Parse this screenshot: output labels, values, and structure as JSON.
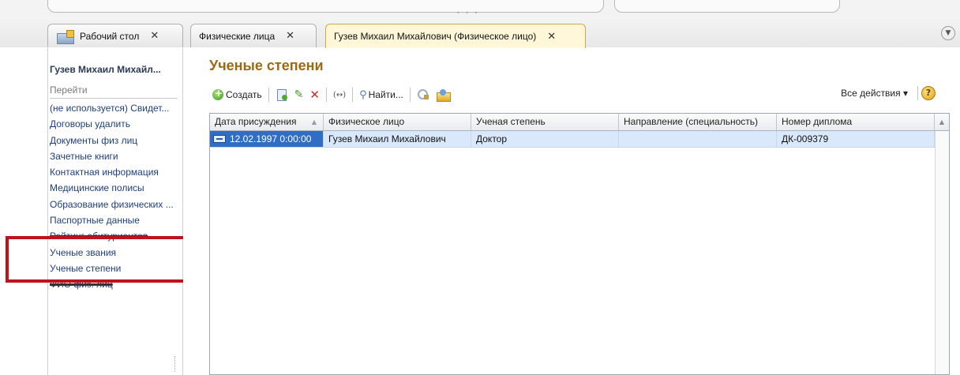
{
  "tabs": [
    {
      "label": "Рабочий стол",
      "close": "✕"
    },
    {
      "label": "Физические лица",
      "close": "✕"
    },
    {
      "label": "Гузев Михаил Михайлович (Физическое лицо)",
      "close": "✕"
    }
  ],
  "tabs_menu_icon": "chevron-down-icon",
  "left_panel": {
    "title": "Гузев Михаил Михайл...",
    "section": "Перейти",
    "items": [
      "(не используется) Свидет...",
      "Договоры удалить",
      "Документы физ лиц",
      "Зачетные книги",
      "Контактная информация",
      "Медицинские полисы",
      "Образование физических ...",
      "Паспортные данные",
      "Рейтинг абитуриентов",
      "Ученые звания",
      "Ученые степени",
      "ФИО физ. лиц"
    ]
  },
  "main": {
    "title": "Ученые степени",
    "toolbar": {
      "create_label": "Создать",
      "find_label": "Найти...",
      "all_actions_label": "Все действия ▾",
      "help_label": "?",
      "link_label": "(↔)"
    },
    "table": {
      "columns": [
        "Дата присуждения",
        "Физическое лицо",
        "Ученая степень",
        "Направление (специальность)",
        "Номер диплома"
      ],
      "sort_indicator": "▲",
      "rows": [
        [
          "12.02.1997 0:00:00",
          "Гузев Михаил Михайлович",
          "Доктор",
          "",
          "ДК-009379"
        ]
      ]
    }
  },
  "highlight_color": "#c0121c",
  "accent_title_color": "#9a6a14"
}
